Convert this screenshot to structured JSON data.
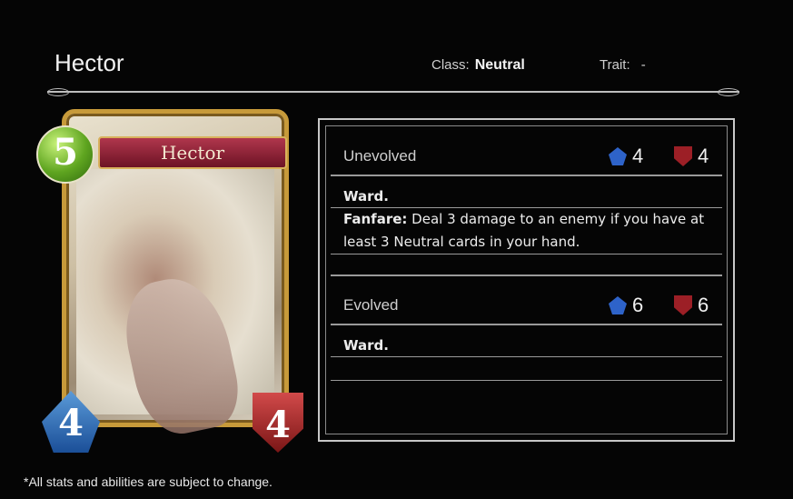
{
  "header": {
    "name": "Hector",
    "class_label": "Class:",
    "class_value": "Neutral",
    "trait_label": "Trait:",
    "trait_value": "-"
  },
  "card": {
    "name": "Hector",
    "cost": "5",
    "attack": "4",
    "defense": "4"
  },
  "unevolved": {
    "label": "Unevolved",
    "attack": "4",
    "defense": "4",
    "line1_keyword": "Ward.",
    "line2_keyword": "Fanfare:",
    "line2_text": " Deal 3 damage to an enemy if you have at least 3 Neutral cards in your hand."
  },
  "evolved": {
    "label": "Evolved",
    "attack": "6",
    "defense": "6",
    "line1_keyword": "Ward."
  },
  "footer": "*All stats and abilities are subject to change.",
  "colors": {
    "cost": "#5fa520",
    "attack": "#2e63c9",
    "defense": "#9c1f26",
    "frame": "#c79a3a"
  }
}
